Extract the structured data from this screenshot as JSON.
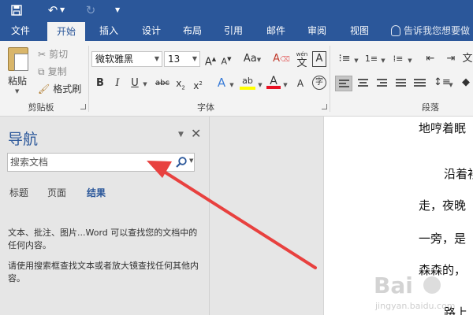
{
  "tabs": [
    {
      "label": "文件",
      "active": false
    },
    {
      "label": "开始",
      "active": true
    },
    {
      "label": "插入",
      "active": false
    },
    {
      "label": "设计",
      "active": false
    },
    {
      "label": "布局",
      "active": false
    },
    {
      "label": "引用",
      "active": false
    },
    {
      "label": "邮件",
      "active": false
    },
    {
      "label": "审阅",
      "active": false
    },
    {
      "label": "视图",
      "active": false
    }
  ],
  "tell_me": "告诉我您想要做",
  "clipboard": {
    "paste": "粘贴",
    "cut": "剪切",
    "copy": "复制",
    "format_painter": "格式刷",
    "group": "剪贴板"
  },
  "font": {
    "name": "微软雅黑",
    "size": "13",
    "group": "字体"
  },
  "paragraph": {
    "group": "段落"
  },
  "nav": {
    "title": "导航",
    "search_placeholder": "搜索文档",
    "tabs": [
      {
        "label": "标题",
        "active": false
      },
      {
        "label": "页面",
        "active": false
      },
      {
        "label": "结果",
        "active": true
      }
    ],
    "message1": "文本、批注、图片...Word 可以查找您的文档中的任何内容。",
    "message2": "请使用搜索框查找文本或者放大镜查找任何其他内容。"
  },
  "document": {
    "lines": [
      "地哼着眠",
      "沿着衫",
      "走，夜晚",
      "一旁，是",
      "森森的，",
      "路上"
    ]
  },
  "watermark": {
    "brand": "Bai",
    "site": "jingyan.baidu.com"
  },
  "colors": {
    "accent": "#2b579a",
    "arrow": "#e8413f",
    "highlight": "#ffff00",
    "font_color": "#e81123"
  }
}
